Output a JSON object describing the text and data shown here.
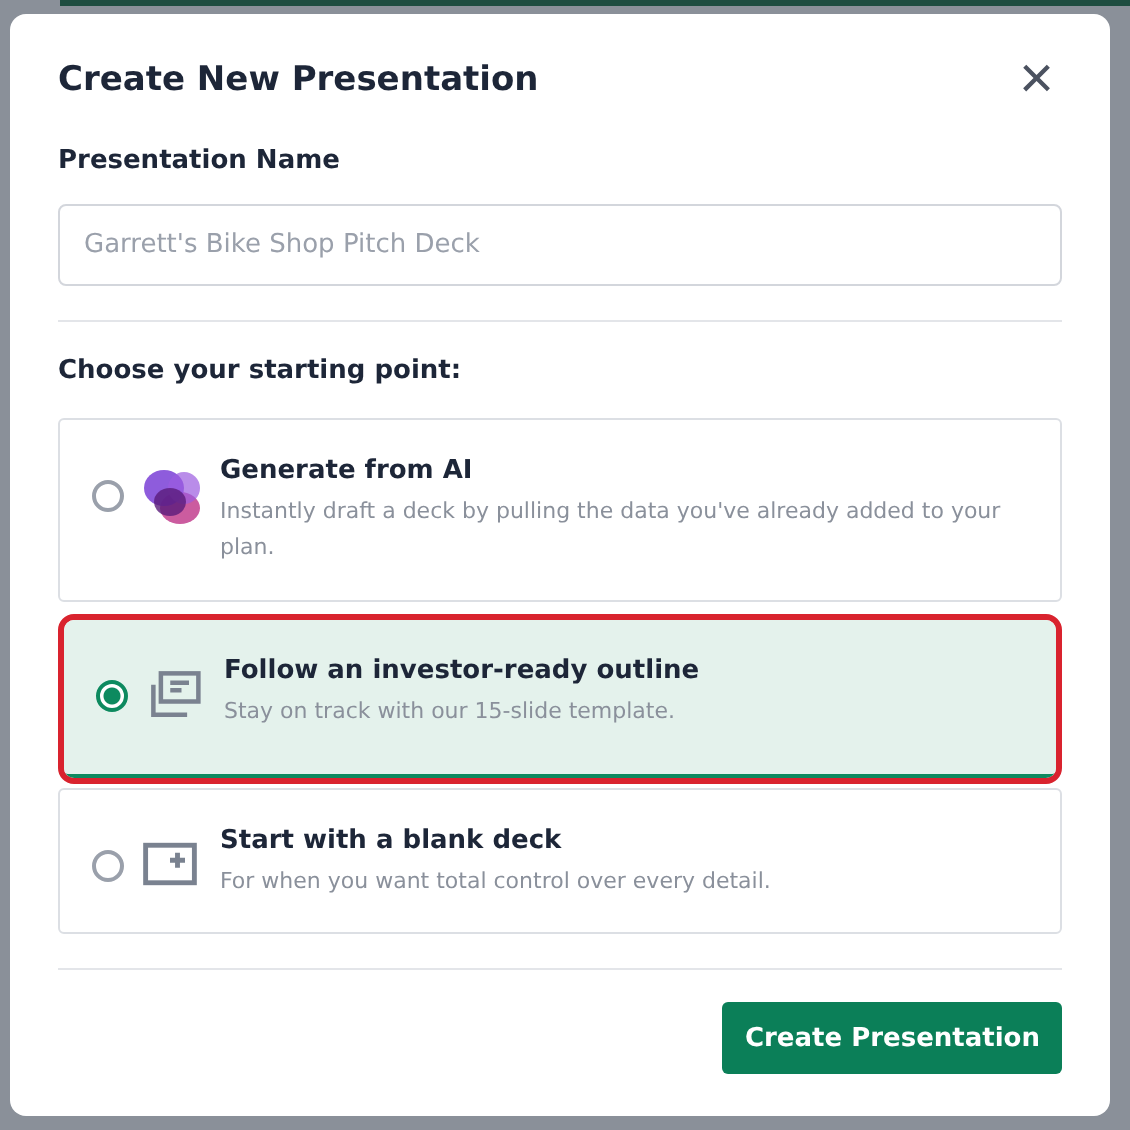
{
  "dialog": {
    "title": "Create New Presentation",
    "close_label": "×"
  },
  "name_field": {
    "label": "Presentation Name",
    "placeholder": "Garrett's Bike Shop Pitch Deck"
  },
  "options_heading": "Choose your starting point:",
  "options": [
    {
      "kind": "ai",
      "title": "Generate from AI",
      "description": "Instantly draft a deck by pulling the data you've already added to your plan.",
      "selected": false
    },
    {
      "kind": "outline",
      "title": "Follow an investor-ready outline",
      "description": "Stay on track with our 15-slide template.",
      "selected": true
    },
    {
      "kind": "blank",
      "title": "Start with a blank deck",
      "description": "For when you want total control over every detail.",
      "selected": false
    }
  ],
  "primary_button": "Create Presentation"
}
